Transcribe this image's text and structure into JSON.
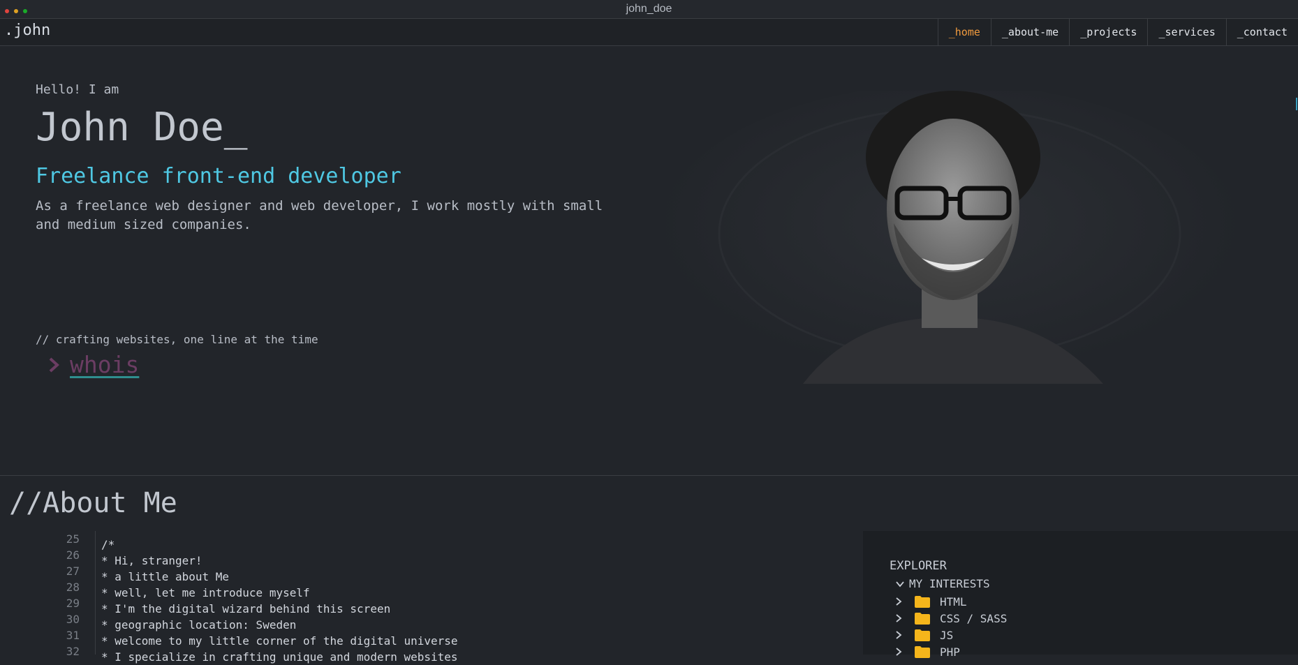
{
  "window": {
    "title": "john_doe"
  },
  "nav": {
    "logo": ".john",
    "items": [
      {
        "label": "_home",
        "active": true
      },
      {
        "label": "_about-me"
      },
      {
        "label": "_projects"
      },
      {
        "label": "_services"
      },
      {
        "label": "_contact"
      }
    ]
  },
  "hero": {
    "greeting": "Hello! I am",
    "name": "John Doe_",
    "role": "Freelance front-end developer",
    "description": "As a freelance web designer and web developer, I work mostly with small and medium sized companies.",
    "comment": "// crafting websites, one line at the time",
    "typed_command": "whois"
  },
  "about": {
    "title": "//About Me",
    "line_numbers": [
      "25",
      "26",
      "27",
      "28",
      "29",
      "30",
      "31",
      "32"
    ],
    "lines": [
      "/*",
      "* Hi, stranger!",
      "* a little about Me",
      "* well, let me introduce myself",
      "* I'm the digital wizard behind this screen",
      "* geographic location: Sweden",
      "* welcome to my little corner of the digital universe",
      "* I specialize in crafting unique and modern websites"
    ]
  },
  "explorer": {
    "title": "EXPLORER",
    "section": "MY INTERESTS",
    "folders": [
      "HTML",
      "CSS / SASS",
      "JS",
      "PHP"
    ]
  },
  "colors": {
    "background": "#22252a",
    "accent_orange": "#f09a3e",
    "accent_cyan": "#4fc8e3",
    "folder_yellow": "#f5b51b"
  }
}
